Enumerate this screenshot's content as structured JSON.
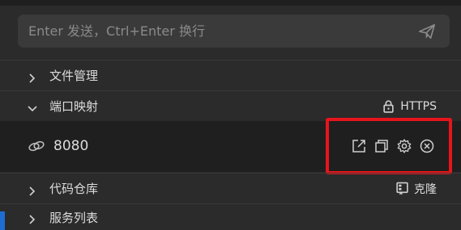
{
  "input": {
    "placeholder": "Enter 发送，Ctrl+Enter 换行",
    "value": ""
  },
  "sections": {
    "files": {
      "label": "文件管理"
    },
    "ports": {
      "label": "端口映射",
      "action_label": "HTTPS"
    },
    "repo": {
      "label": "代码仓库",
      "action_label": "克隆"
    },
    "services": {
      "label": "服务列表"
    }
  },
  "port_item": {
    "port": "8080"
  },
  "icons": {
    "send": "send-icon",
    "lock": "lock-icon",
    "link": "link-icon",
    "open": "open-external-icon",
    "copy": "copy-icon",
    "settings": "gear-icon",
    "close": "close-icon",
    "repo": "repo-icon"
  },
  "colors": {
    "highlight": "#e8141b",
    "accent": "#1c6fd1"
  }
}
